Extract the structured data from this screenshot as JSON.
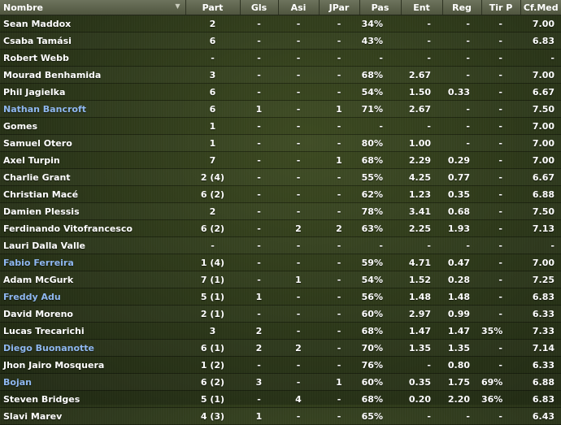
{
  "columns": {
    "name": "Nombre",
    "part": "Part",
    "gls": "Gls",
    "asi": "Asi",
    "jpar": "JPar",
    "pas": "Pas",
    "ent": "Ent",
    "reg": "Reg",
    "tir": "Tir P",
    "rating": "Cf.Med"
  },
  "rows": [
    {
      "name": "Sean Maddox",
      "part": "2",
      "gls": "-",
      "asi": "-",
      "jpar": "-",
      "pas": "34%",
      "ent": "-",
      "reg": "-",
      "tir": "-",
      "rating": "7.00",
      "highlight": false
    },
    {
      "name": "Csaba Tamási",
      "part": "6",
      "gls": "-",
      "asi": "-",
      "jpar": "-",
      "pas": "43%",
      "ent": "-",
      "reg": "-",
      "tir": "-",
      "rating": "6.83",
      "highlight": false
    },
    {
      "name": "Robert Webb",
      "part": "-",
      "gls": "-",
      "asi": "-",
      "jpar": "-",
      "pas": "-",
      "ent": "-",
      "reg": "-",
      "tir": "-",
      "rating": "-",
      "highlight": false
    },
    {
      "name": "Mourad Benhamida",
      "part": "3",
      "gls": "-",
      "asi": "-",
      "jpar": "-",
      "pas": "68%",
      "ent": "2.67",
      "reg": "-",
      "tir": "-",
      "rating": "7.00",
      "highlight": false
    },
    {
      "name": "Phil Jagielka",
      "part": "6",
      "gls": "-",
      "asi": "-",
      "jpar": "-",
      "pas": "54%",
      "ent": "1.50",
      "reg": "0.33",
      "tir": "-",
      "rating": "6.67",
      "highlight": false
    },
    {
      "name": "Nathan Bancroft",
      "part": "6",
      "gls": "1",
      "asi": "-",
      "jpar": "1",
      "pas": "71%",
      "ent": "2.67",
      "reg": "-",
      "tir": "-",
      "rating": "7.50",
      "highlight": true
    },
    {
      "name": "Gomes",
      "part": "1",
      "gls": "-",
      "asi": "-",
      "jpar": "-",
      "pas": "-",
      "ent": "-",
      "reg": "-",
      "tir": "-",
      "rating": "7.00",
      "highlight": false
    },
    {
      "name": "Samuel Otero",
      "part": "1",
      "gls": "-",
      "asi": "-",
      "jpar": "-",
      "pas": "80%",
      "ent": "1.00",
      "reg": "-",
      "tir": "-",
      "rating": "7.00",
      "highlight": false
    },
    {
      "name": "Axel Turpin",
      "part": "7",
      "gls": "-",
      "asi": "-",
      "jpar": "1",
      "pas": "68%",
      "ent": "2.29",
      "reg": "0.29",
      "tir": "-",
      "rating": "7.00",
      "highlight": false
    },
    {
      "name": "Charlie Grant",
      "part": "2 (4)",
      "gls": "-",
      "asi": "-",
      "jpar": "-",
      "pas": "55%",
      "ent": "4.25",
      "reg": "0.77",
      "tir": "-",
      "rating": "6.67",
      "highlight": false
    },
    {
      "name": "Christian Macé",
      "part": "6 (2)",
      "gls": "-",
      "asi": "-",
      "jpar": "-",
      "pas": "62%",
      "ent": "1.23",
      "reg": "0.35",
      "tir": "-",
      "rating": "6.88",
      "highlight": false
    },
    {
      "name": "Damien Plessis",
      "part": "2",
      "gls": "-",
      "asi": "-",
      "jpar": "-",
      "pas": "78%",
      "ent": "3.41",
      "reg": "0.68",
      "tir": "-",
      "rating": "7.50",
      "highlight": false
    },
    {
      "name": "Ferdinando Vitofrancesco",
      "part": "6 (2)",
      "gls": "-",
      "asi": "2",
      "jpar": "2",
      "pas": "63%",
      "ent": "2.25",
      "reg": "1.93",
      "tir": "-",
      "rating": "7.13",
      "highlight": false
    },
    {
      "name": "Lauri Dalla Valle",
      "part": "-",
      "gls": "-",
      "asi": "-",
      "jpar": "-",
      "pas": "-",
      "ent": "-",
      "reg": "-",
      "tir": "-",
      "rating": "-",
      "highlight": false
    },
    {
      "name": "Fabio Ferreira",
      "part": "1 (4)",
      "gls": "-",
      "asi": "-",
      "jpar": "-",
      "pas": "59%",
      "ent": "4.71",
      "reg": "0.47",
      "tir": "-",
      "rating": "7.00",
      "highlight": true
    },
    {
      "name": "Adam McGurk",
      "part": "7 (1)",
      "gls": "-",
      "asi": "1",
      "jpar": "-",
      "pas": "54%",
      "ent": "1.52",
      "reg": "0.28",
      "tir": "-",
      "rating": "7.25",
      "highlight": false
    },
    {
      "name": "Freddy Adu",
      "part": "5 (1)",
      "gls": "1",
      "asi": "-",
      "jpar": "-",
      "pas": "56%",
      "ent": "1.48",
      "reg": "1.48",
      "tir": "-",
      "rating": "6.83",
      "highlight": true
    },
    {
      "name": "David Moreno",
      "part": "2 (1)",
      "gls": "-",
      "asi": "-",
      "jpar": "-",
      "pas": "60%",
      "ent": "2.97",
      "reg": "0.99",
      "tir": "-",
      "rating": "6.33",
      "highlight": false
    },
    {
      "name": "Lucas Trecarichi",
      "part": "3",
      "gls": "2",
      "asi": "-",
      "jpar": "-",
      "pas": "68%",
      "ent": "1.47",
      "reg": "1.47",
      "tir": "35%",
      "rating": "7.33",
      "highlight": false
    },
    {
      "name": "Diego Buonanotte",
      "part": "6 (1)",
      "gls": "2",
      "asi": "2",
      "jpar": "-",
      "pas": "70%",
      "ent": "1.35",
      "reg": "1.35",
      "tir": "-",
      "rating": "7.14",
      "highlight": true
    },
    {
      "name": "Jhon Jairo Mosquera",
      "part": "1 (2)",
      "gls": "-",
      "asi": "-",
      "jpar": "-",
      "pas": "76%",
      "ent": "-",
      "reg": "0.80",
      "tir": "-",
      "rating": "6.33",
      "highlight": false
    },
    {
      "name": "Bojan",
      "part": "6 (2)",
      "gls": "3",
      "asi": "-",
      "jpar": "1",
      "pas": "60%",
      "ent": "0.35",
      "reg": "1.75",
      "tir": "69%",
      "rating": "6.88",
      "highlight": true
    },
    {
      "name": "Steven Bridges",
      "part": "5 (1)",
      "gls": "-",
      "asi": "4",
      "jpar": "-",
      "pas": "68%",
      "ent": "0.20",
      "reg": "2.20",
      "tir": "36%",
      "rating": "6.83",
      "highlight": false
    },
    {
      "name": "Slavi Marev",
      "part": "4 (3)",
      "gls": "1",
      "asi": "-",
      "jpar": "-",
      "pas": "65%",
      "ent": "-",
      "reg": "-",
      "tir": "-",
      "rating": "6.43",
      "highlight": false
    }
  ],
  "colors": {
    "highlight_name": "#8fb8f0",
    "header_bg": "#5e644c",
    "background": "#2c3719"
  },
  "icons": {
    "sort": "sort-down-icon"
  }
}
